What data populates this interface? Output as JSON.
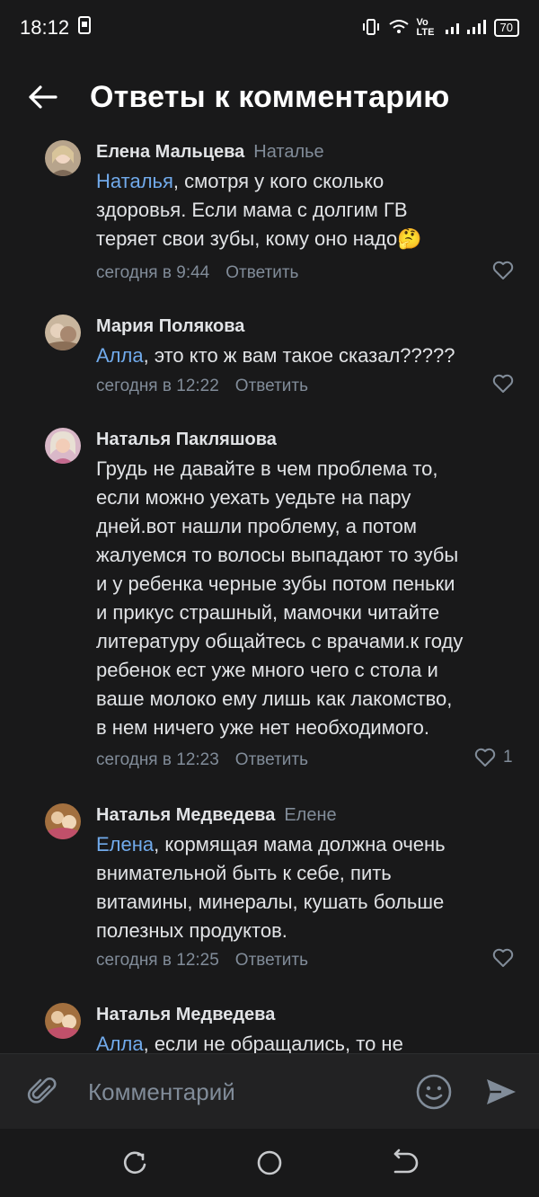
{
  "status_bar": {
    "time": "18:12",
    "network": "Vo LTE",
    "battery": "70"
  },
  "header": {
    "title": "Ответы к комментарию"
  },
  "comments": [
    {
      "author": "Елена Мальцева",
      "reply_to": "Наталье",
      "mention": "Наталья",
      "text_lines": [
        ", смотря у кого сколько",
        "здоровья. Если мама с долгим ГВ",
        "теряет свои зубы, кому оно надо🤔"
      ],
      "time": "сегодня в 9:44",
      "answer": "Ответить",
      "likes": ""
    },
    {
      "author": "Мария Полякова",
      "reply_to": "",
      "mention": "Алла",
      "text_lines": [
        ", это кто ж вам такое сказал?????"
      ],
      "time": "сегодня в 12:22",
      "answer": "Ответить",
      "likes": ""
    },
    {
      "author": "Наталья Пакляшова",
      "reply_to": "",
      "mention": "",
      "text_lines": [
        "Грудь не давайте в чем проблема то,",
        "если можно уехать уедьте на пару",
        "дней.вот нашли проблему, а потом",
        "жалуемся то волосы выпадают то зубы",
        "и у ребенка черные зубы потом пеньки",
        "и прикус страшный, мамочки читайте",
        "литературу общайтесь с врачами.к году",
        "ребенок ест уже много чего с стола и",
        "ваше молоко ему лишь как лакомство,",
        "в нем ничего уже нет необходимого."
      ],
      "time": "сегодня в 12:23",
      "answer": "Ответить",
      "likes": "1"
    },
    {
      "author": "Наталья Медведева",
      "reply_to": "Елене",
      "mention": "Елена",
      "text_lines": [
        ", кормящая мама должна очень",
        "внимательной быть к себе, пить",
        "витамины, минералы, кушать больше",
        "полезных продуктов."
      ],
      "time": "сегодня в 12:25",
      "answer": "Ответить",
      "likes": ""
    },
    {
      "author": "Наталья Медведева",
      "reply_to": "",
      "mention": "Алла",
      "text_lines": [
        ", если не обращались, то не"
      ],
      "time": "",
      "answer": "",
      "likes": ""
    }
  ],
  "composer": {
    "placeholder": "Комментарий"
  },
  "colors": {
    "accent": "#71aaeb",
    "background": "#19191a",
    "secondary_text": "#818c99"
  }
}
